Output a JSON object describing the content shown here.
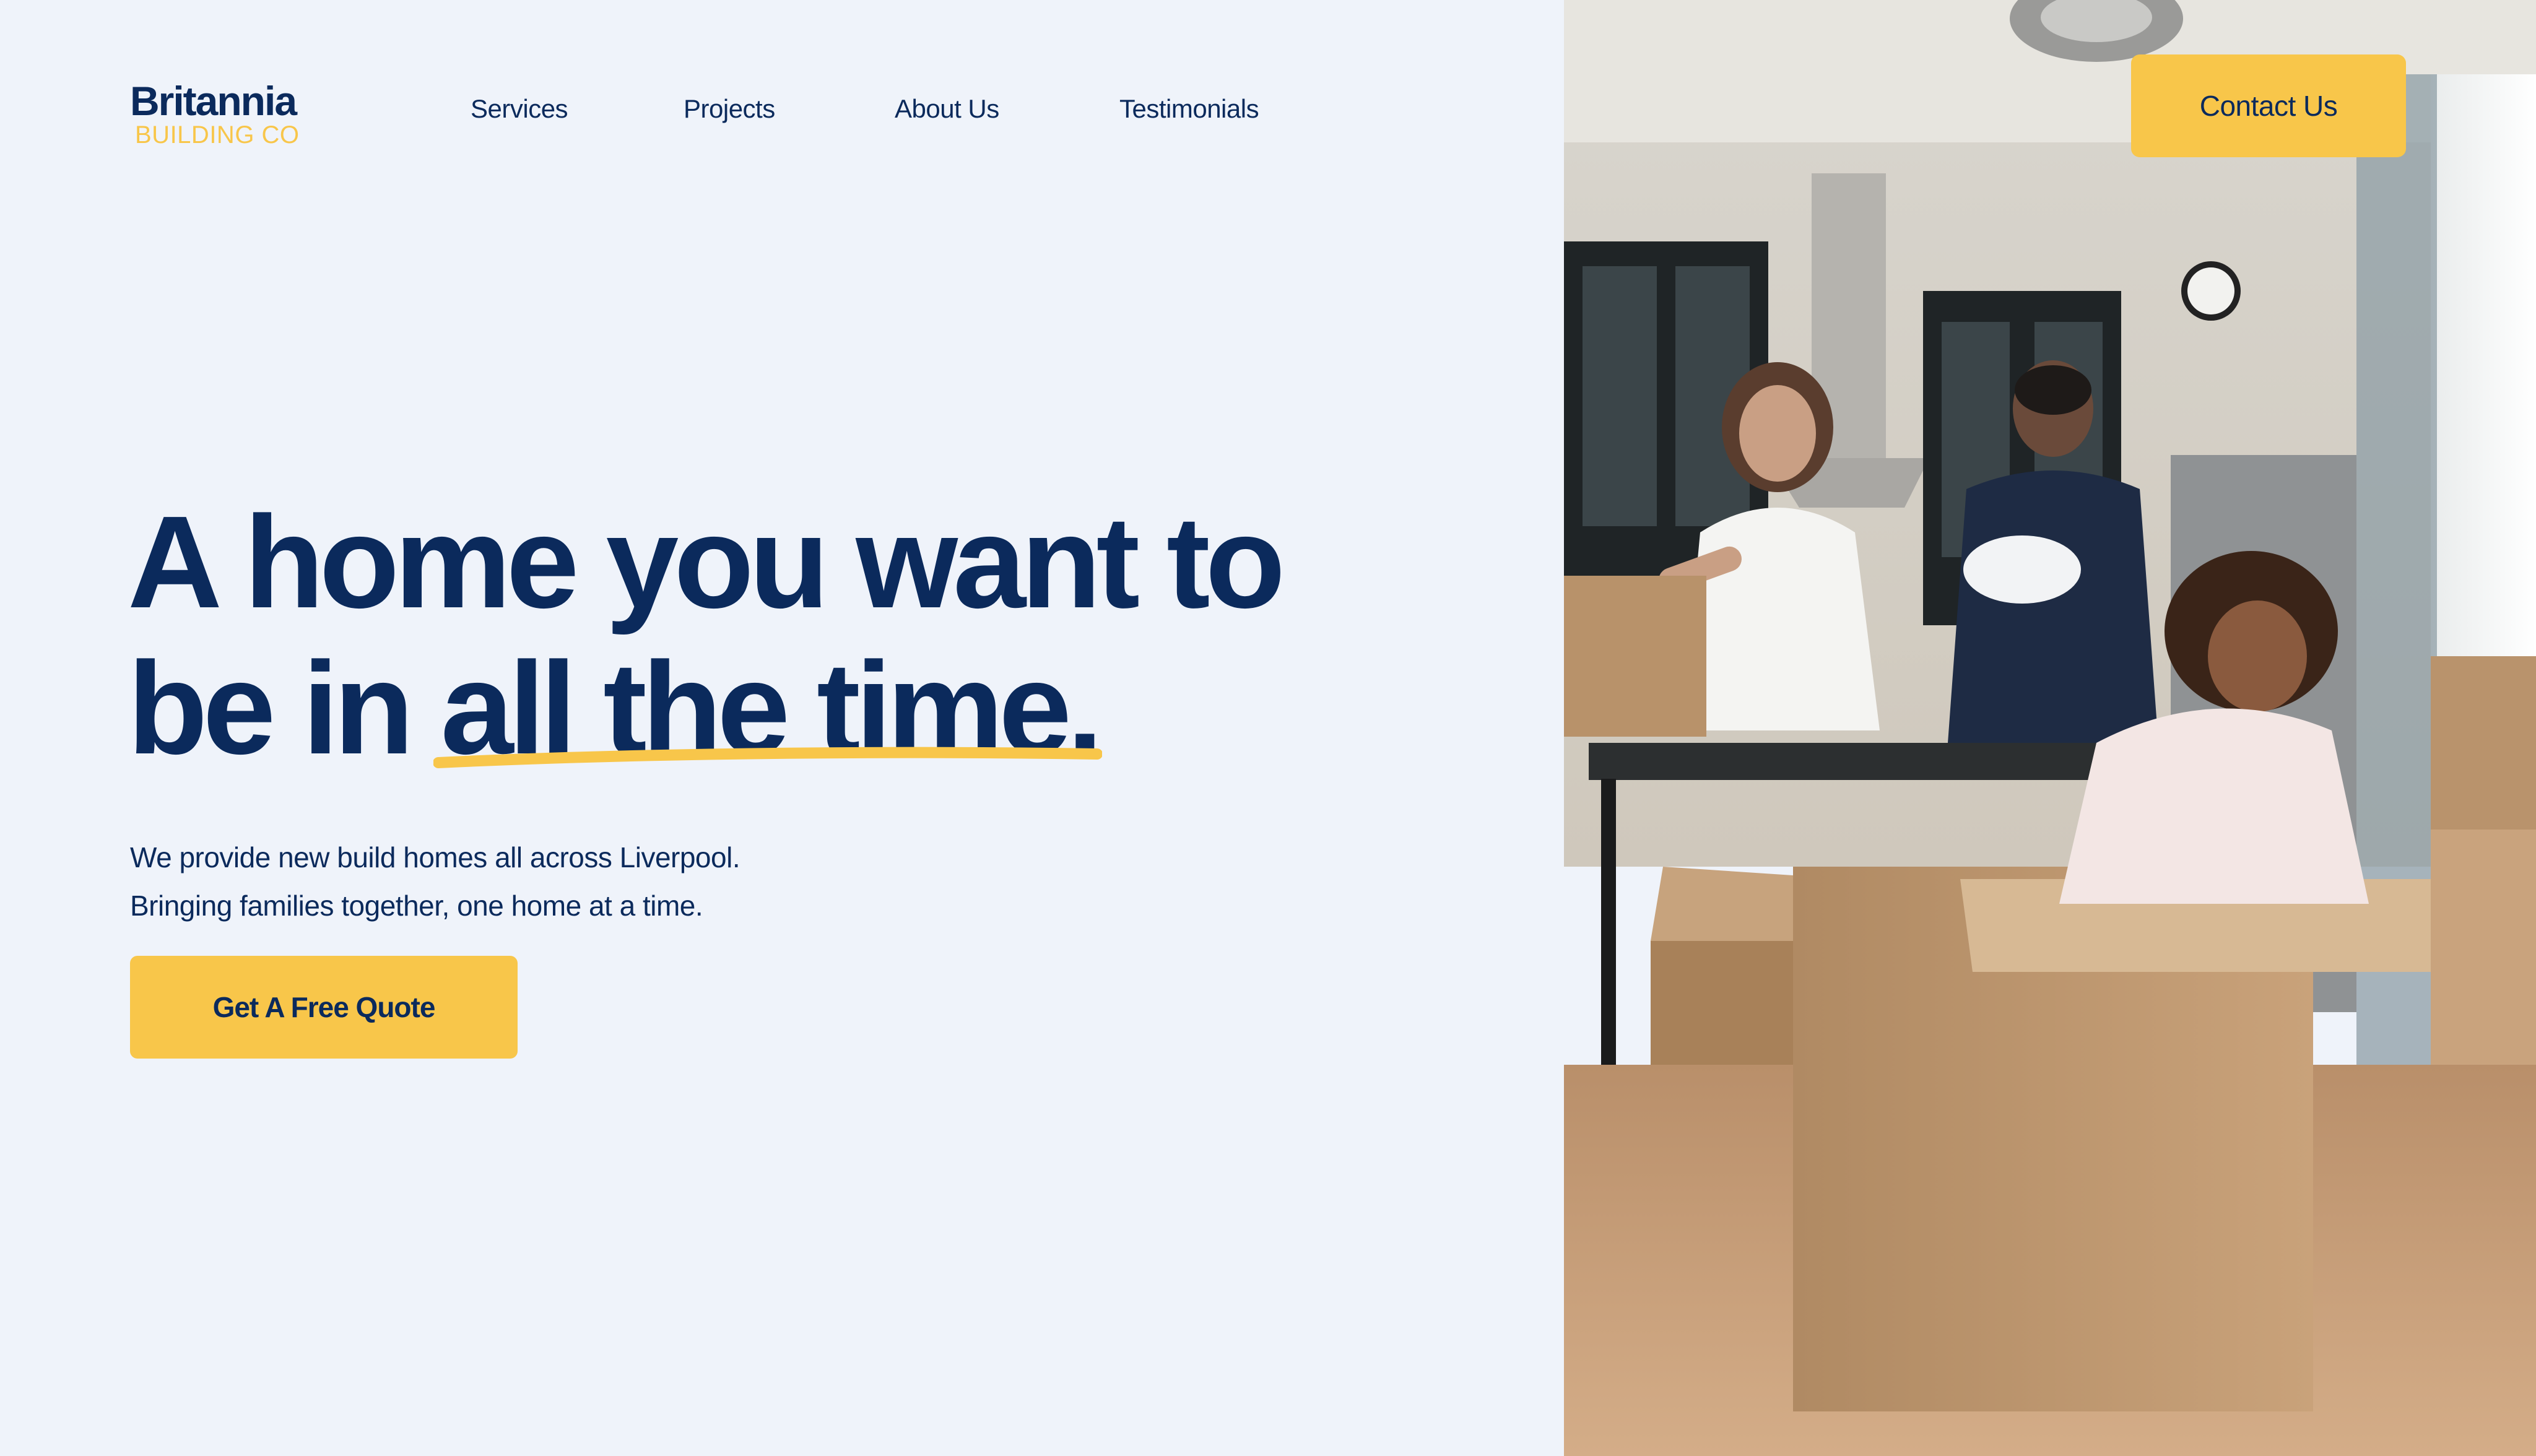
{
  "brand": {
    "name": "Britannia",
    "tagline": "BUILDING CO"
  },
  "nav": {
    "items": [
      "Services",
      "Projects",
      "About Us",
      "Testimonials"
    ]
  },
  "header": {
    "contact_label": "Contact Us"
  },
  "hero": {
    "title_line1": "A home you want to",
    "title_line2": "be in all the time.",
    "subtitle_line1": "We provide new build homes all across Liverpool.",
    "subtitle_line2": "Bringing families together, one home at a time.",
    "cta_label": "Get A Free Quote"
  },
  "colors": {
    "navy": "#0b2a5c",
    "accent": "#f8c64a",
    "background": "#eff3fa"
  },
  "photo": {
    "subject": "family-unpacking-boxes-in-kitchen"
  }
}
